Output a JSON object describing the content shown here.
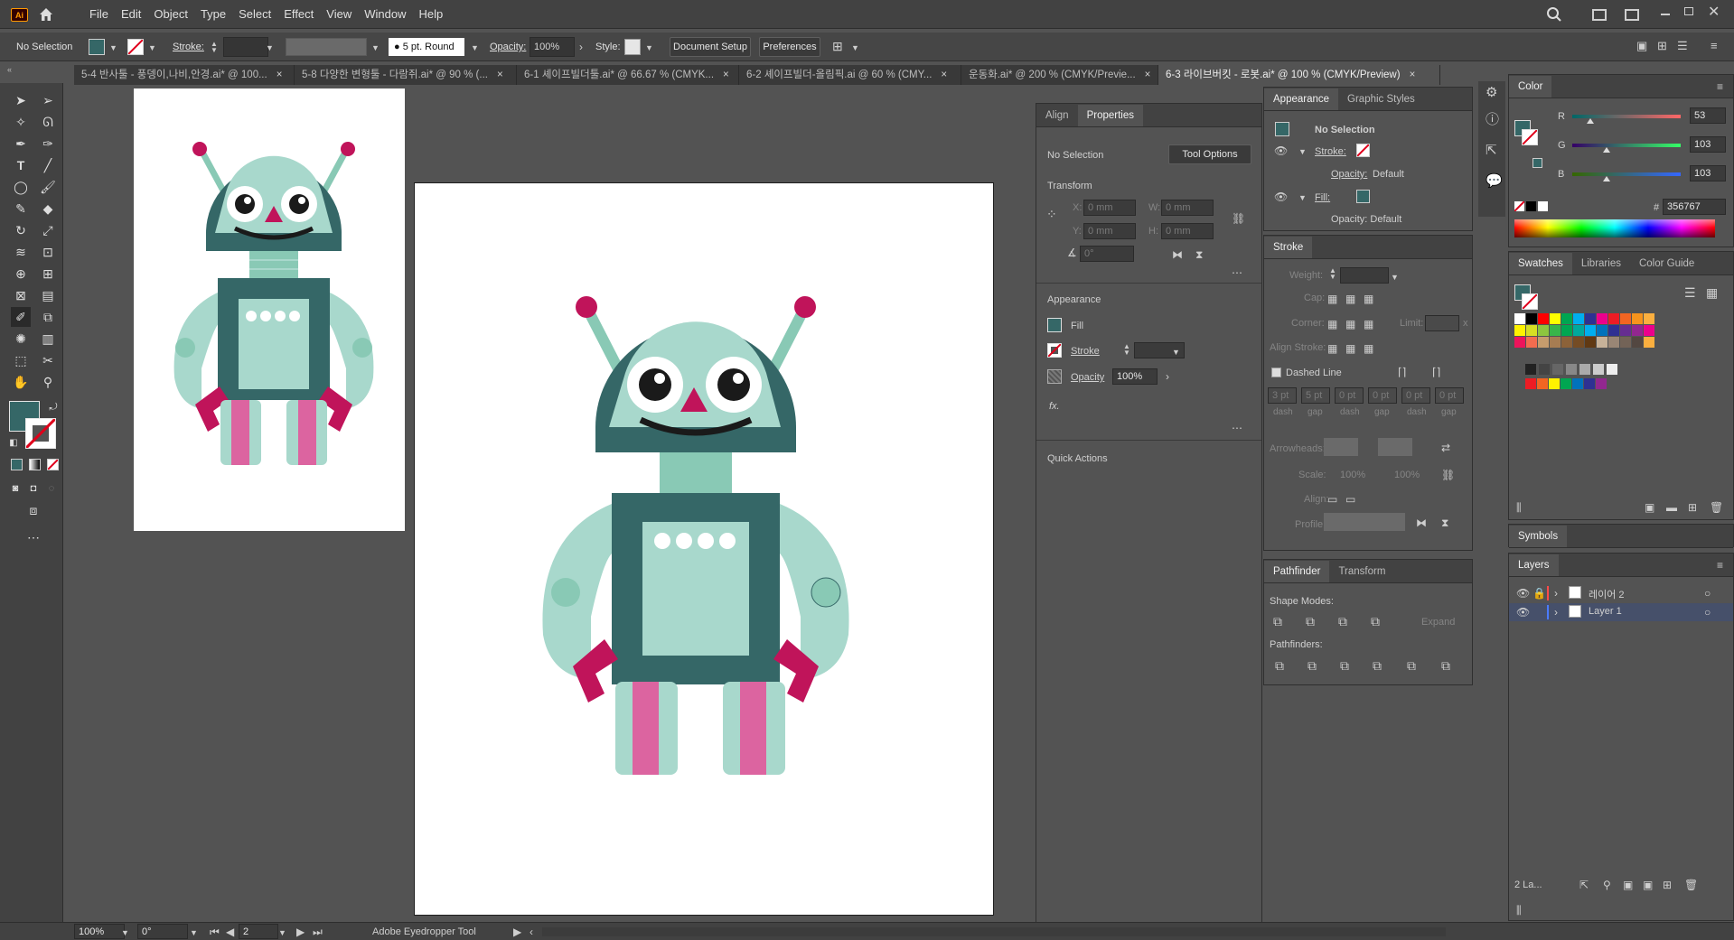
{
  "app": {
    "logo": "Ai"
  },
  "menu": [
    "File",
    "Edit",
    "Object",
    "Type",
    "Select",
    "Effect",
    "View",
    "Window",
    "Help"
  ],
  "control": {
    "selection": "No Selection",
    "stroke_label": "Stroke:",
    "brush": "5 pt. Round",
    "opacity_label": "Opacity:",
    "opacity_value": "100%",
    "style_label": "Style:",
    "doc_setup": "Document Setup",
    "preferences": "Preferences"
  },
  "tabs": [
    "5-4 반사툴 - 풍뎅이,나비,안경.ai* @ 100...",
    "5-8 다양한 변형툴 - 다람쥐.ai* @ 90 % (...",
    "6-1 셰이프빌더툴.ai* @ 66.67 % (CMYK...",
    "6-2 셰이프빌더-올림픽.ai @ 60 % (CMY...",
    "운동화.ai* @ 200 % (CMYK/Previe...",
    "6-3 라이브버킷 - 로봇.ai* @ 100 % (CMYK/Preview)"
  ],
  "tab_close": "×",
  "colors": {
    "accent_teal": "#356767",
    "light_teal": "#a8d8cc",
    "magenta": "#c0145a",
    "pink": "#dc64a0",
    "mid_teal": "#89c9b5"
  },
  "properties": {
    "tabs": [
      "Align",
      "Properties"
    ],
    "no_selection": "No Selection",
    "tool_options": "Tool Options",
    "transform": "Transform",
    "x_label": "X:",
    "y_label": "Y:",
    "w_label": "W:",
    "h_label": "H:",
    "x": "0 mm",
    "y": "0 mm",
    "w": "0 mm",
    "h": "0 mm",
    "angle": "0°",
    "appearance": "Appearance",
    "fill": "Fill",
    "stroke": "Stroke",
    "opacity": "Opacity",
    "opacity_value": "100%",
    "fx": "fx.",
    "quick_actions": "Quick Actions"
  },
  "appearance_panel": {
    "tabs": [
      "Appearance",
      "Graphic Styles"
    ],
    "title": "No Selection",
    "stroke": "Stroke:",
    "opacity": "Opacity:",
    "opacity_value": "Default",
    "fill": "Fill:",
    "opacity2": "Opacity: Default"
  },
  "stroke_panel": {
    "title": "Stroke",
    "weight": "Weight:",
    "cap": "Cap:",
    "corner": "Corner:",
    "limit": "Limit:",
    "limit_x": "x",
    "align_stroke": "Align Stroke:",
    "dashed_line": "Dashed Line",
    "dash_values": [
      "3 pt",
      "5 pt",
      "0 pt",
      "0 pt",
      "0 pt",
      "0 pt"
    ],
    "dash_labels": [
      "dash",
      "gap",
      "dash",
      "gap",
      "dash",
      "gap"
    ],
    "arrowheads": "Arrowheads:",
    "scale": "Scale:",
    "scale_value": "100%",
    "align": "Align:",
    "profile": "Profile:"
  },
  "pathfinder": {
    "tabs": [
      "Pathfinder",
      "Transform"
    ],
    "shape_modes": "Shape Modes:",
    "expand": "Expand",
    "pathfinders": "Pathfinders:"
  },
  "color_panel": {
    "title": "Color",
    "r_label": "R",
    "g_label": "G",
    "b_label": "B",
    "r": "53",
    "g": "103",
    "b": "103",
    "r_level": 0.21,
    "g_level": 0.4,
    "b_level": 0.4,
    "hex_label": "#",
    "hex": "356767"
  },
  "swatches": {
    "tabs": [
      "Swatches",
      "Libraries",
      "Color Guide"
    ],
    "row1": [
      "#ffffff",
      "#000000",
      "#ff0000",
      "#ffff00",
      "#00a651",
      "#00aeef",
      "#2e3192",
      "#ec008c",
      "#ed1c24",
      "#f26522",
      "#f7941d",
      "#fbaf3f"
    ],
    "row2": [
      "#fff200",
      "#d7df23",
      "#8dc63f",
      "#39b54a",
      "#00a651",
      "#00a99d",
      "#00aeef",
      "#0072bc",
      "#2e3192",
      "#662d91",
      "#92278f",
      "#ec008c"
    ],
    "row3": [
      "#ed145b",
      "#f26c4f",
      "#c69c6d",
      "#a67c52",
      "#8c6239",
      "#754c24",
      "#603913",
      "#c7b299",
      "#998675",
      "#736357",
      "#534741",
      "#fbaf3f"
    ],
    "row4": [
      "#222222",
      "#444444",
      "#666666",
      "#888888",
      "#aaaaaa",
      "#cccccc",
      "#eeeeee"
    ],
    "row5": [
      "#ed1c24",
      "#f26522",
      "#fff200",
      "#00a651",
      "#0072bc",
      "#2e3192",
      "#92278f"
    ]
  },
  "symbols": {
    "title": "Symbols"
  },
  "layers": {
    "title": "Layers",
    "items": [
      "레이어 2",
      "Layer 1"
    ],
    "count": "2 La..."
  },
  "status": {
    "zoom": "100%",
    "angle": "0°",
    "artboard": "2",
    "tool": "Adobe Eyedropper Tool"
  }
}
